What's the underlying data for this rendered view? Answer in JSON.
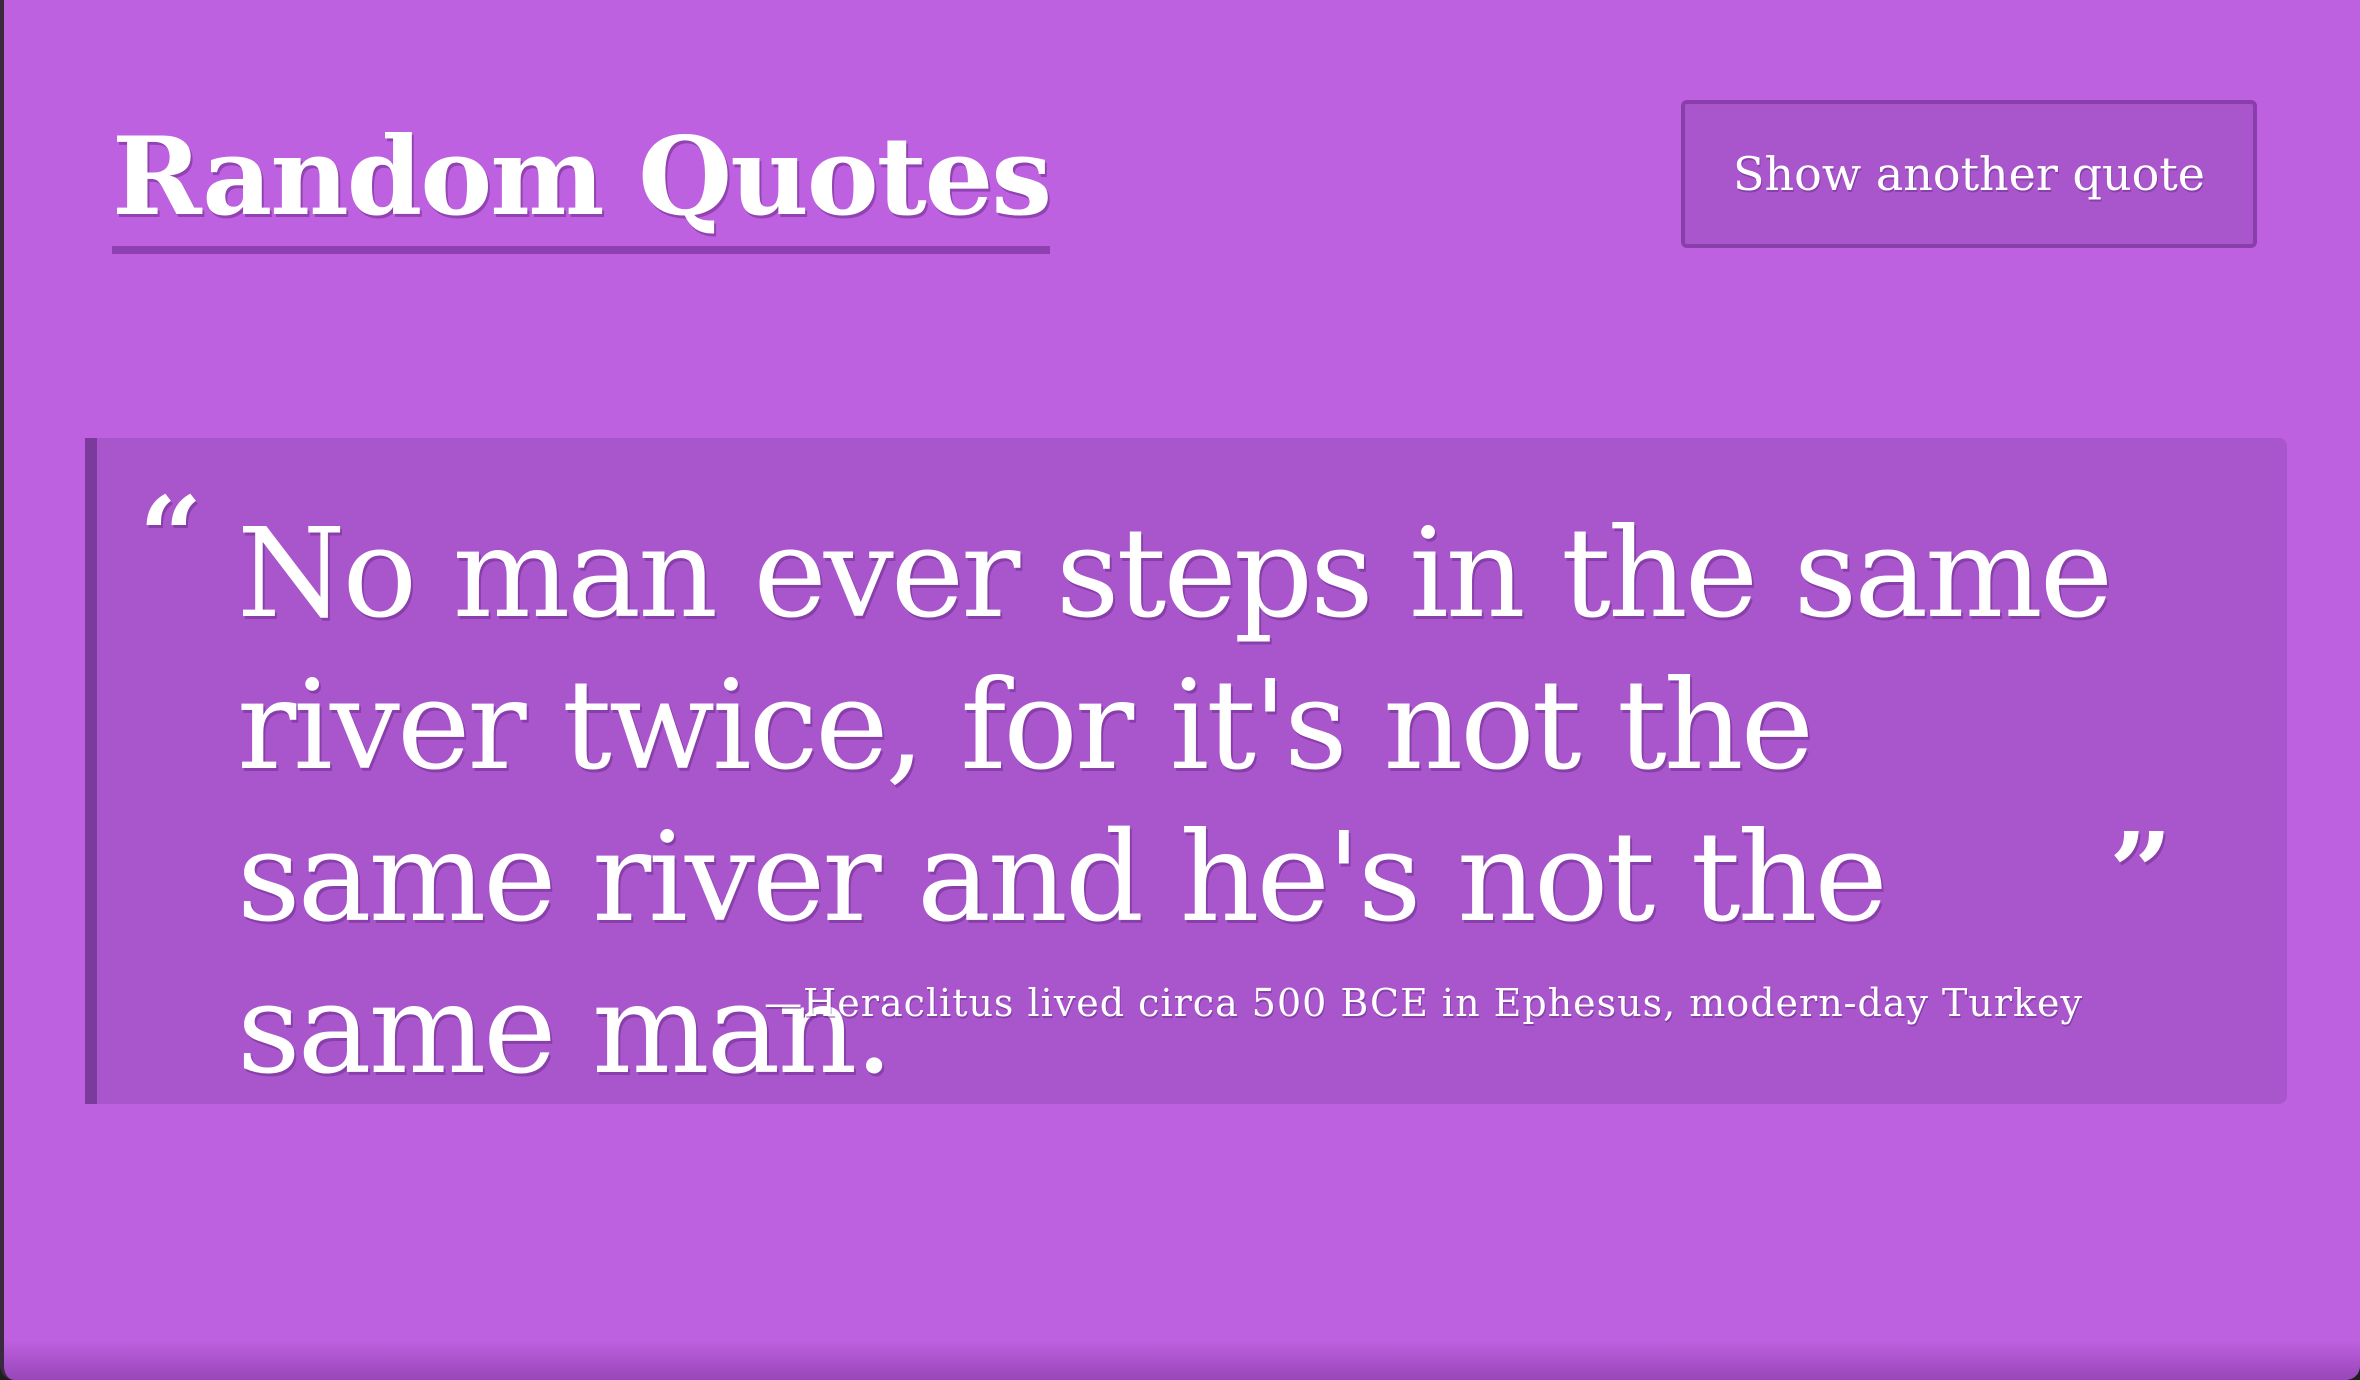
{
  "header": {
    "title": "Random Quotes",
    "button_label": "Show another quote"
  },
  "quote": {
    "open_mark": "“",
    "text": "No man ever steps in the same river twice, for it's not the same river and he's not the same man.",
    "close_mark": "”",
    "attribution": "—Heraclitus lived circa 500 BCE in Ephesus, modern-day Turkey"
  },
  "colors": {
    "background": "#be61e0",
    "card": "#a956cc",
    "card_border": "#7d3a9d",
    "title_underline": "#8e3fb0",
    "text": "#ffffff"
  }
}
